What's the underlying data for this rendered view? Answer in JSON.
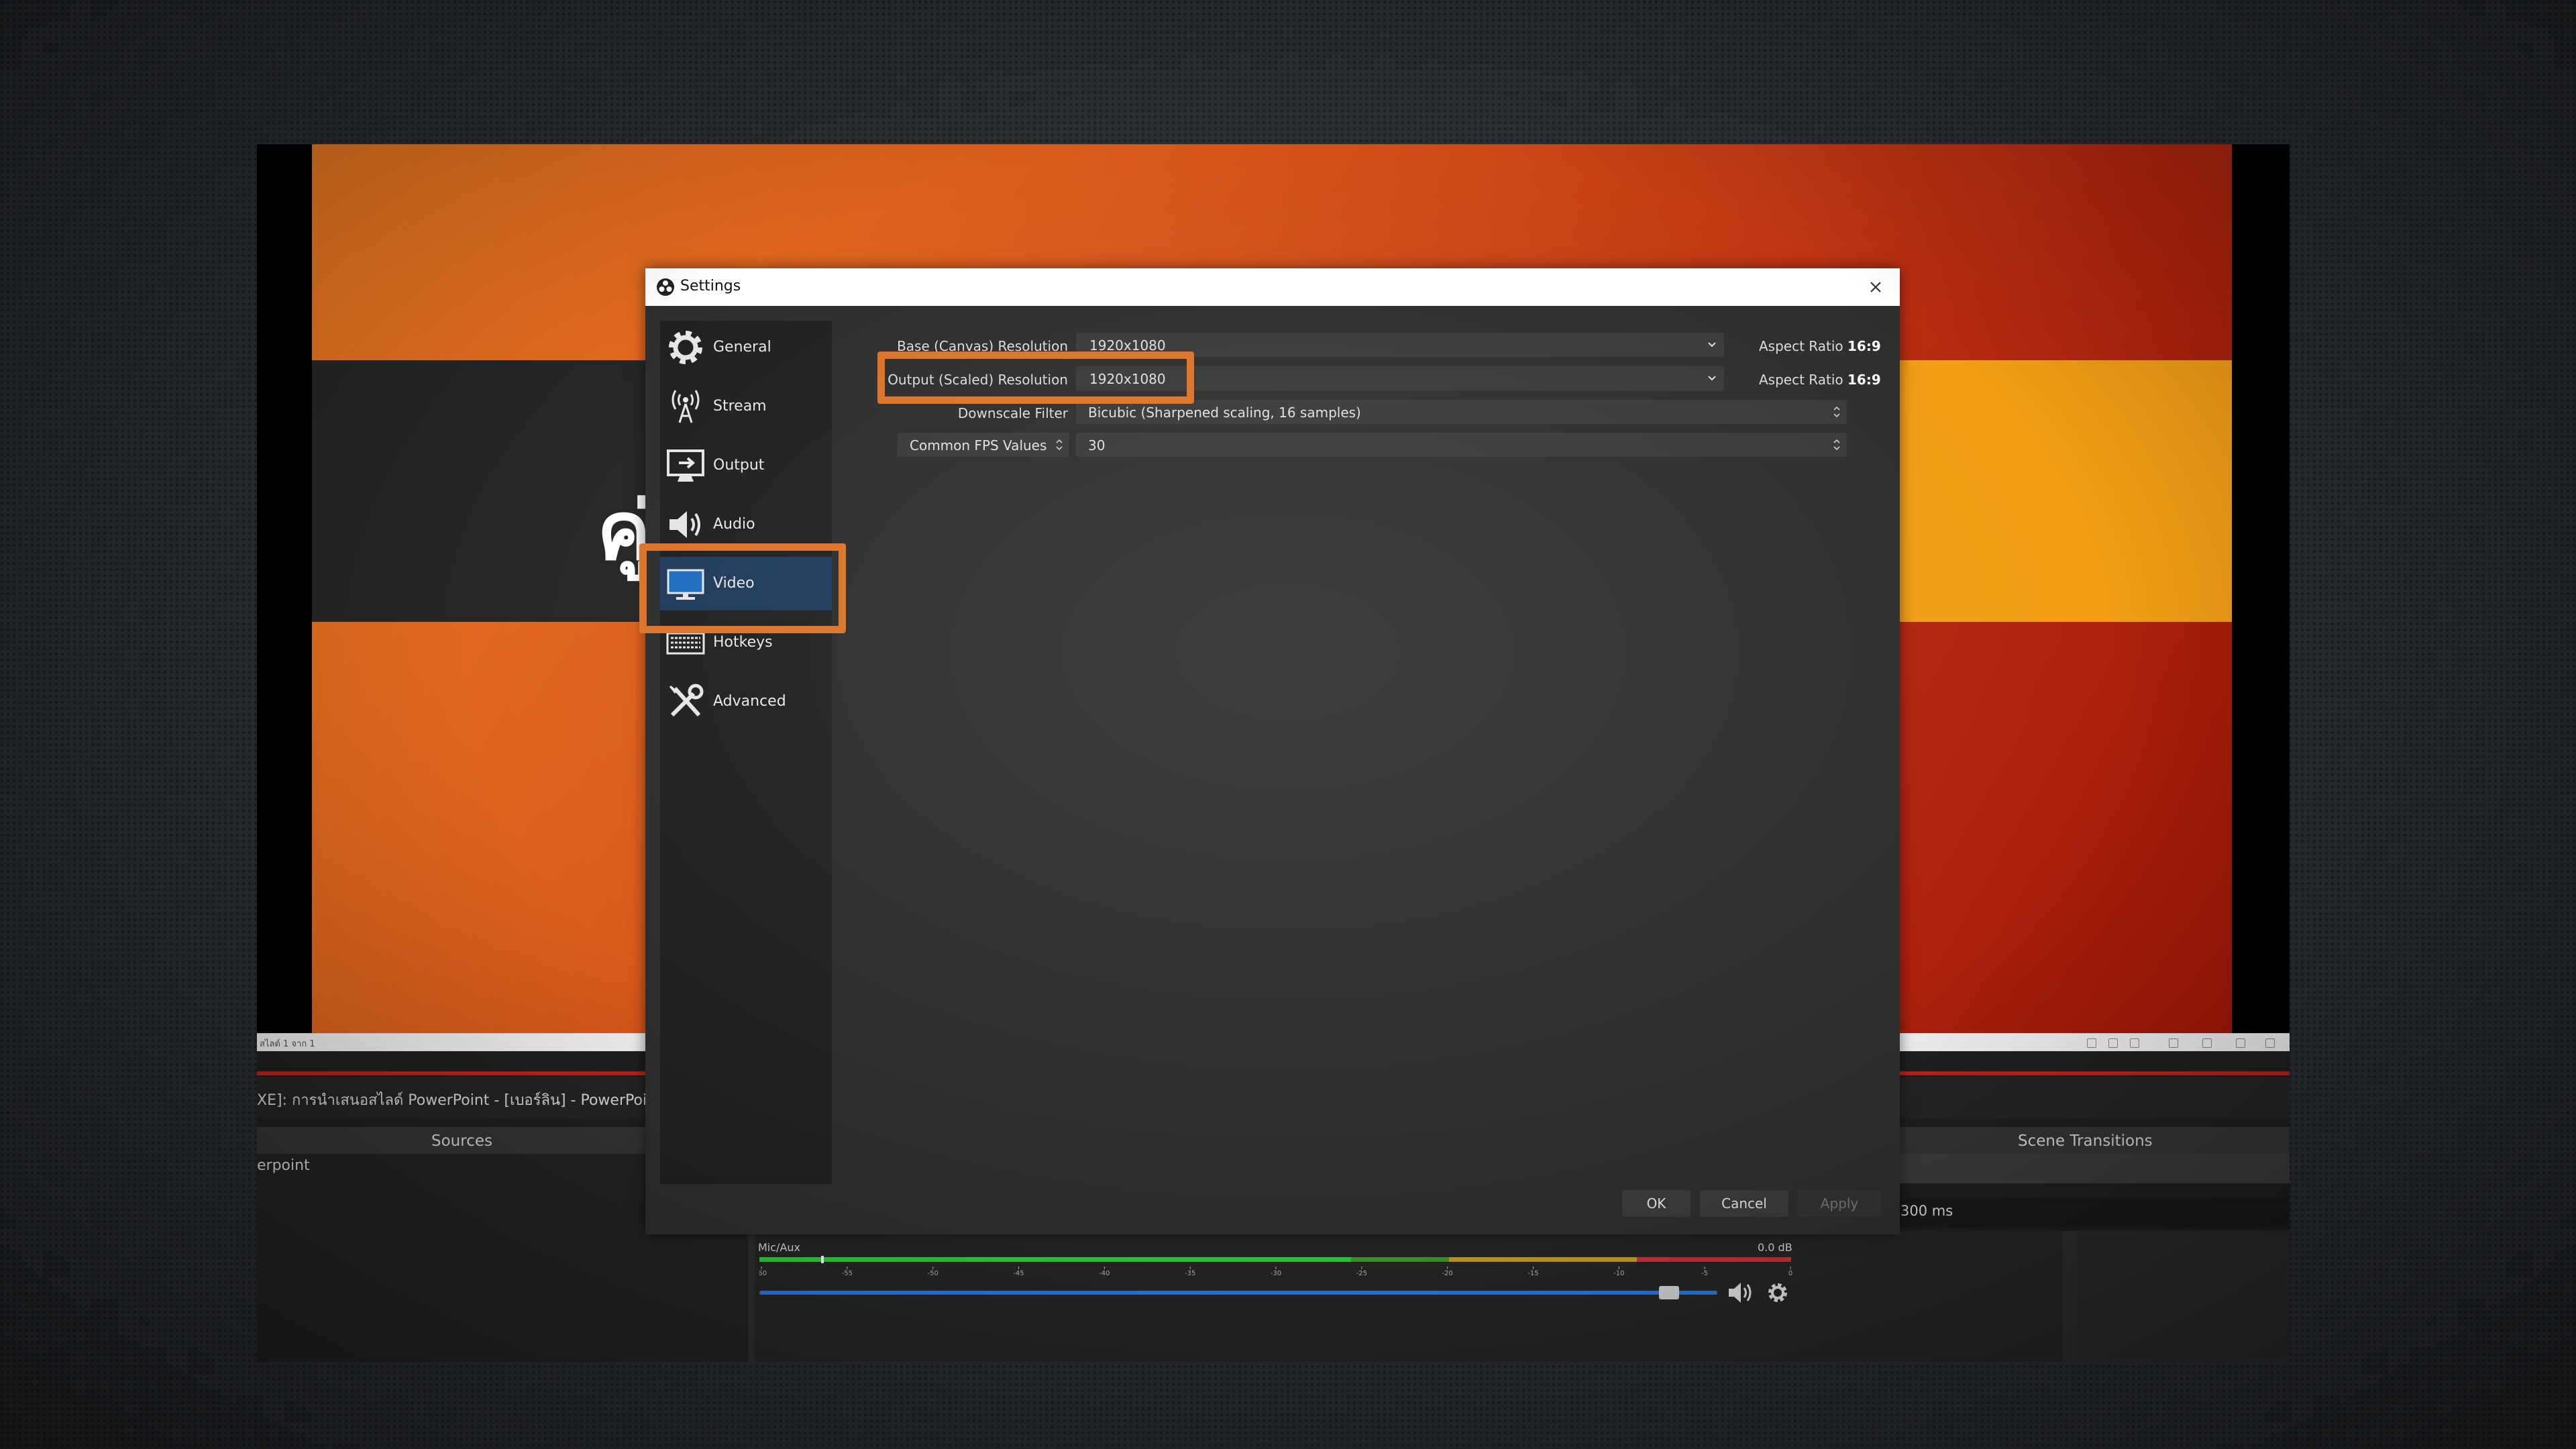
{
  "obs": {
    "window_title": "XE]: การนำเสนอสไลด์ PowerPoint - [เบอร์ลิน] - PowerPoint",
    "slide_glyph": "คู่",
    "ppt_status": "สไลด์ 1 จาก 1",
    "docks": {
      "sources_title": "Sources",
      "source_item": "erpoint",
      "transitions_title": "Scene Transitions",
      "transition_duration": "300 ms"
    },
    "mixer": {
      "track_name": "Mic/Aux",
      "level_db": "0.0 dB",
      "ticks": [
        "-60",
        "-55",
        "-50",
        "-45",
        "-40",
        "-35",
        "-30",
        "-25",
        "-20",
        "-15",
        "-10",
        "-5",
        "0"
      ],
      "volume_fraction": 0.96,
      "peak_fraction": 0.06
    }
  },
  "settings": {
    "title": "Settings",
    "nav": [
      {
        "label": "General",
        "icon": "gear-icon",
        "active": false
      },
      {
        "label": "Stream",
        "icon": "antenna-icon",
        "active": false
      },
      {
        "label": "Output",
        "icon": "output-icon",
        "active": false
      },
      {
        "label": "Audio",
        "icon": "speaker-icon",
        "active": false
      },
      {
        "label": "Video",
        "icon": "monitor-icon",
        "active": true
      },
      {
        "label": "Hotkeys",
        "icon": "keyboard-icon",
        "active": false
      },
      {
        "label": "Advanced",
        "icon": "tools-icon",
        "active": false
      }
    ],
    "video": {
      "base_label": "Base (Canvas) Resolution",
      "base_value": "1920x1080",
      "base_aspect_prefix": "Aspect Ratio",
      "base_aspect": "16:9",
      "output_label": "Output (Scaled) Resolution",
      "output_value": "1920x1080",
      "output_aspect_prefix": "Aspect Ratio",
      "output_aspect": "16:9",
      "filter_label": "Downscale Filter",
      "filter_value": "Bicubic (Sharpened scaling, 16 samples)",
      "fps_type": "Common FPS Values",
      "fps_value": "30"
    },
    "buttons": {
      "ok": "OK",
      "cancel": "Cancel",
      "apply": "Apply"
    }
  },
  "colors": {
    "highlight": "#dc7428",
    "active_nav": "#1f3b5c",
    "volume_bar": "#2e7bdc"
  }
}
